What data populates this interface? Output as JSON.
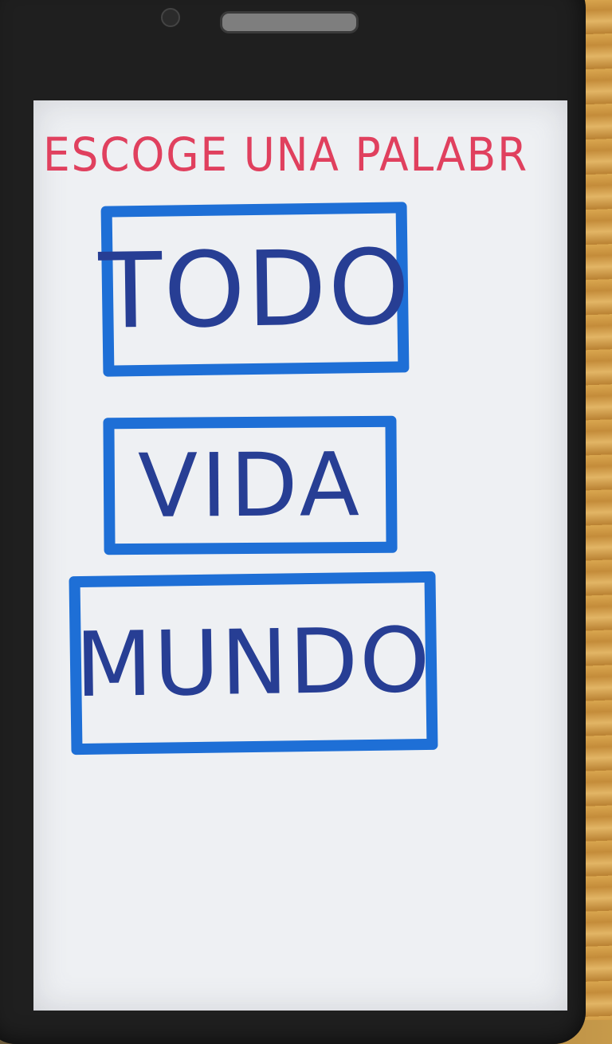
{
  "screen": {
    "title": "ESCOGE UNA PALABRA"
  },
  "words": [
    {
      "label": "TODO"
    },
    {
      "label": "VIDA"
    },
    {
      "label": "MUNDO"
    }
  ],
  "colors": {
    "title": "#e0405e",
    "button_border": "#1e6fd6",
    "button_text": "#273e94",
    "screen_background": "#eef0f3"
  }
}
